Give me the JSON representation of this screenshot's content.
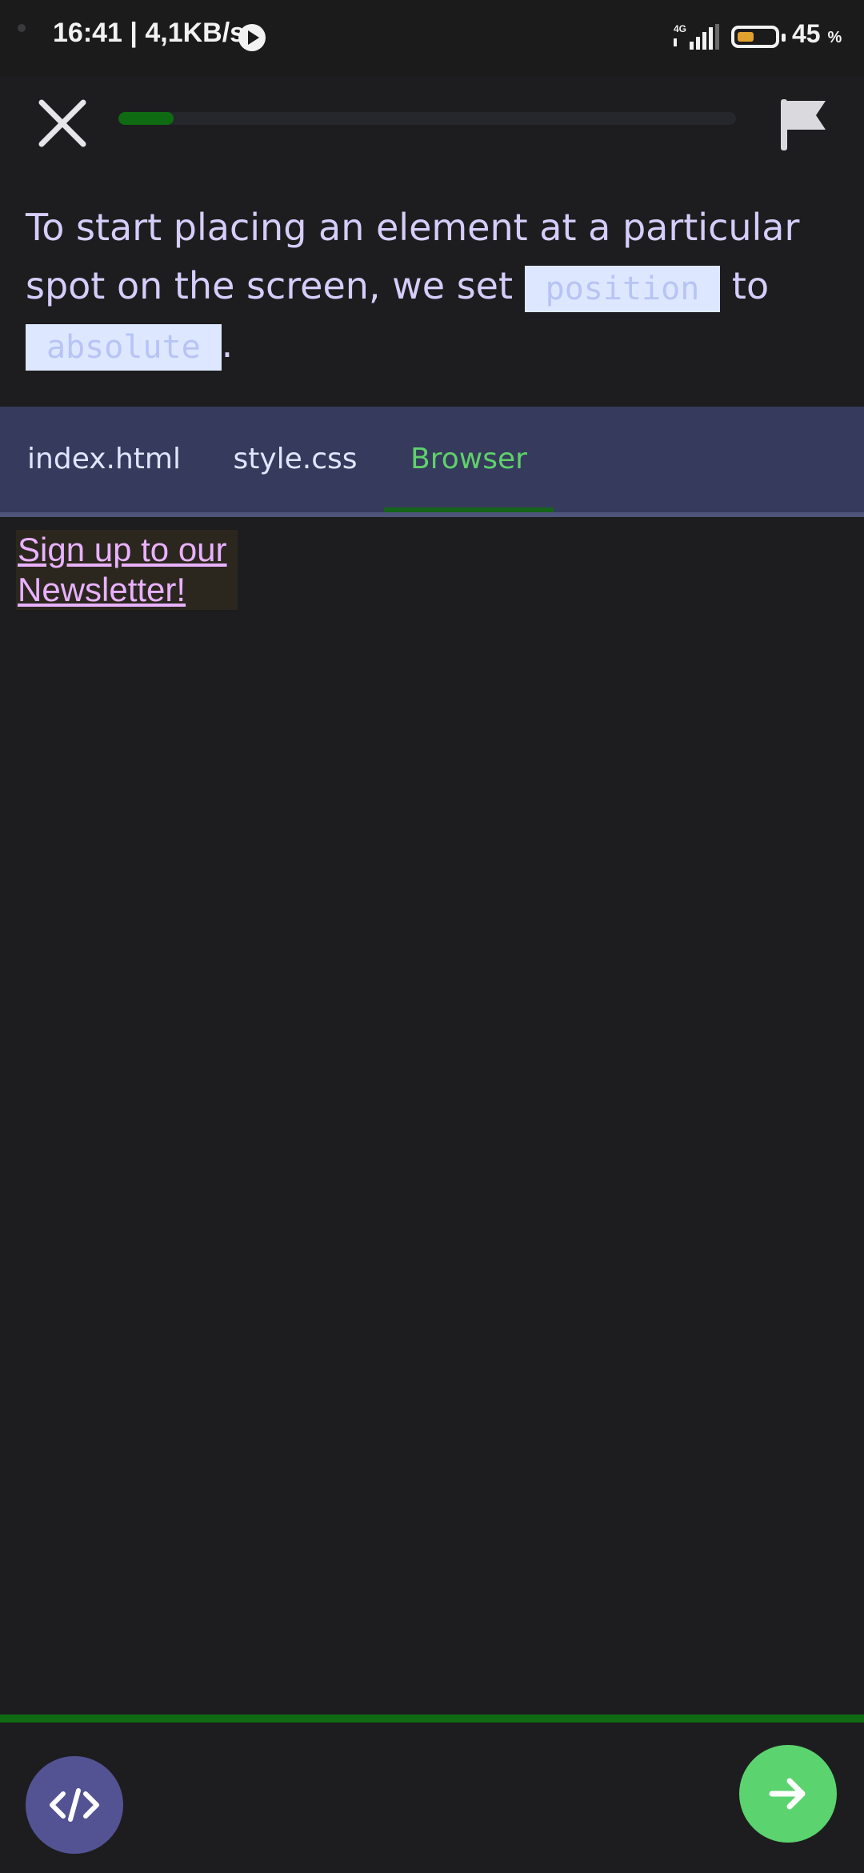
{
  "status_bar": {
    "time_speed": "16:41 | 4,1KB/s",
    "network_label": "4G",
    "battery_percent": "45",
    "battery_unit": "%"
  },
  "top_bar": {
    "progress_fraction": 0.09,
    "close_icon": "close-icon",
    "flag_icon": "flag-icon"
  },
  "instruction": {
    "text_before": "To start placing an element at a particular spot on the screen, we set ",
    "code1": "position",
    "text_middle": " to ",
    "code2": "absolute",
    "text_after": "."
  },
  "tabs": {
    "items": [
      {
        "label": "index.html",
        "active": false
      },
      {
        "label": "style.css",
        "active": false
      },
      {
        "label": "Browser",
        "active": true
      }
    ]
  },
  "browser": {
    "link_text": "Sign up to our Newsletter!"
  },
  "colors": {
    "accent_green": "#5bd36e",
    "progress_green": "#0f6b12",
    "tab_bar": "#363a5c",
    "code_button": "#535394"
  }
}
